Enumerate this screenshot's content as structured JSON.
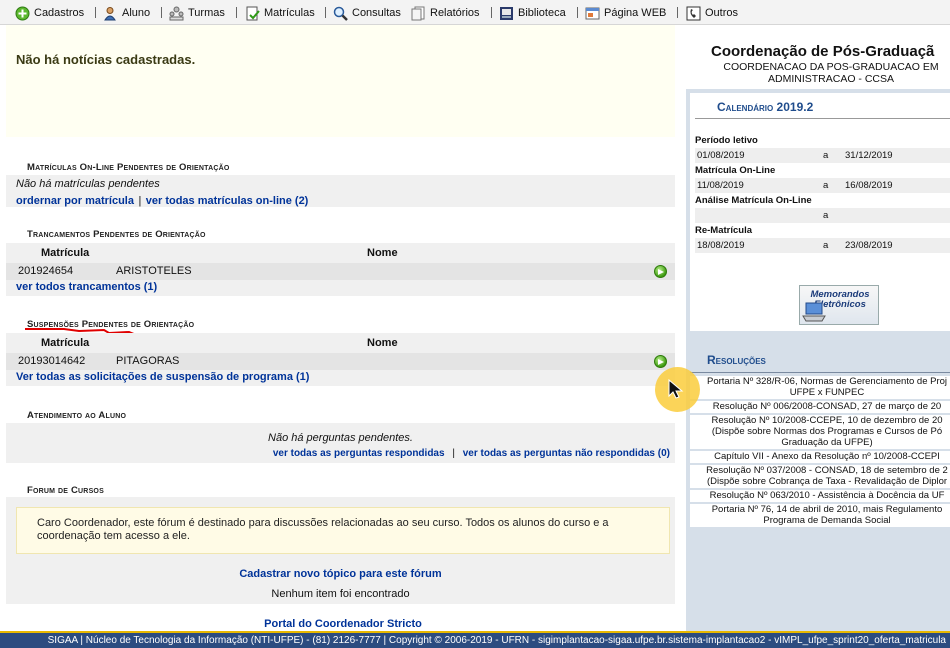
{
  "menu": {
    "items": [
      {
        "label": "Cadastros",
        "icon": "plus-circle-icon"
      },
      {
        "label": "Aluno",
        "icon": "student-icon"
      },
      {
        "label": "Turmas",
        "icon": "class-icon"
      },
      {
        "label": "Matrículas",
        "icon": "enrollment-icon"
      },
      {
        "label": "Consultas",
        "icon": "magnifier-icon"
      },
      {
        "label": "Relatórios",
        "icon": "report-icon"
      },
      {
        "label": "Biblioteca",
        "icon": "library-icon"
      },
      {
        "label": "Página WEB",
        "icon": "webpage-icon"
      },
      {
        "label": "Outros",
        "icon": "phone-icon"
      }
    ]
  },
  "news": {
    "empty_text": "Não há notícias cadastradas."
  },
  "matriculas": {
    "title": "Matrículas On-Line Pendentes de Orientação",
    "empty_text": "Não há matrículas pendentes",
    "link_order": "ordernar por matrícula",
    "link_sep": "|",
    "link_all": "ver todas matrículas on-line (2)"
  },
  "trancamentos": {
    "title": "Trancamentos Pendentes de Orientação",
    "col_matricula": "Matrícula",
    "col_nome": "Nome",
    "rows": [
      {
        "matricula": "201924654",
        "nome": "ARISTOTELES"
      }
    ],
    "link_all": "ver todos trancamentos (1)"
  },
  "suspensoes": {
    "title": "Suspensões Pendentes de Orientação",
    "col_matricula": "Matrícula",
    "col_nome": "Nome",
    "rows": [
      {
        "matricula": "20193014642",
        "nome": "PITAGORAS"
      }
    ],
    "link_all": "Ver todas as solicitações de suspensão de programa (1)"
  },
  "atendimento": {
    "title": "Atendimento ao Aluno",
    "empty_text": "Não há perguntas pendentes.",
    "link_answered": "ver todas as perguntas respondidas",
    "link_sep": "|",
    "link_unanswered": "ver todas as perguntas não respondidas (0)"
  },
  "forum": {
    "title": "Forum de Cursos",
    "info": "Caro Coordenador, este fórum é destinado para discussões relacionadas ao seu curso. Todos os alunos do curso e a coordenação tem acesso a ele.",
    "new_topic": "Cadastrar novo tópico para este fórum",
    "empty_text": "Nenhum item foi encontrado"
  },
  "footer": {
    "portal_link": "Portal do Coordenador Stricto",
    "bar_text": "SIGAA | Núcleo de Tecnologia da Informação (NTI-UFPE) - (81) 2126-7777 | Copyright © 2006-2019 - UFRN - sigimplantacao-sigaa.ufpe.br.sistema-implantacao2 - vIMPL_ufpe_sprint20_oferta_matricula"
  },
  "coordenacao": {
    "title": "Coordenação de Pós-Graduaçã",
    "subtitle_1": "COORDENACAO DA POS-GRADUACAO EM",
    "subtitle_2": "ADMINISTRACAO - CCSA"
  },
  "calendario": {
    "title": "Calendário 2019.2",
    "sections": [
      {
        "label": "Período letivo",
        "start": "01/08/2019",
        "sep": "a",
        "end": "31/12/2019"
      },
      {
        "label": "Matrícula On-Line",
        "start": "11/08/2019",
        "sep": "a",
        "end": "16/08/2019"
      },
      {
        "label": "Análise Matrícula On-Line",
        "start": "",
        "sep": "a",
        "end": ""
      },
      {
        "label": "Re-Matrícula",
        "start": "18/08/2019",
        "sep": "a",
        "end": "23/08/2019"
      }
    ]
  },
  "memorandos": {
    "line1": "Memorandos",
    "line2": "Eletrônicos"
  },
  "resolucoes": {
    "title": "Resoluções",
    "items": [
      {
        "l1": "Portaria Nº 328/R-06, Normas de Gerenciamento de Proj",
        "l2": "UFPE x FUNPEC"
      },
      {
        "l1": "Resolução Nº 006/2008-CONSAD, 27 de março de 20",
        "l2": ""
      },
      {
        "l1": "Resolução Nº 10/2008-CCEPE, 10 de dezembro de 20",
        "l2": "(Dispõe sobre Normas dos Programas e Cursos de Pó",
        "l3": "Graduação da UFPE)"
      },
      {
        "l1": "Capítulo VII - Anexo da Resolução nº 10/2008-CCEPI",
        "l2": ""
      },
      {
        "l1": "Resolução Nº 037/2008 - CONSAD, 18 de setembro de 2",
        "l2": "(Dispõe sobre Cobrança de Taxa - Revalidação de Diplor"
      },
      {
        "l1": "Resolução Nº 063/2010 - Assistência à Docência da UF",
        "l2": ""
      },
      {
        "l1": "Portaria Nº 76, 14 de abril de 2010, mais Regulamento",
        "l2": "Programa de Demanda Social"
      }
    ]
  }
}
